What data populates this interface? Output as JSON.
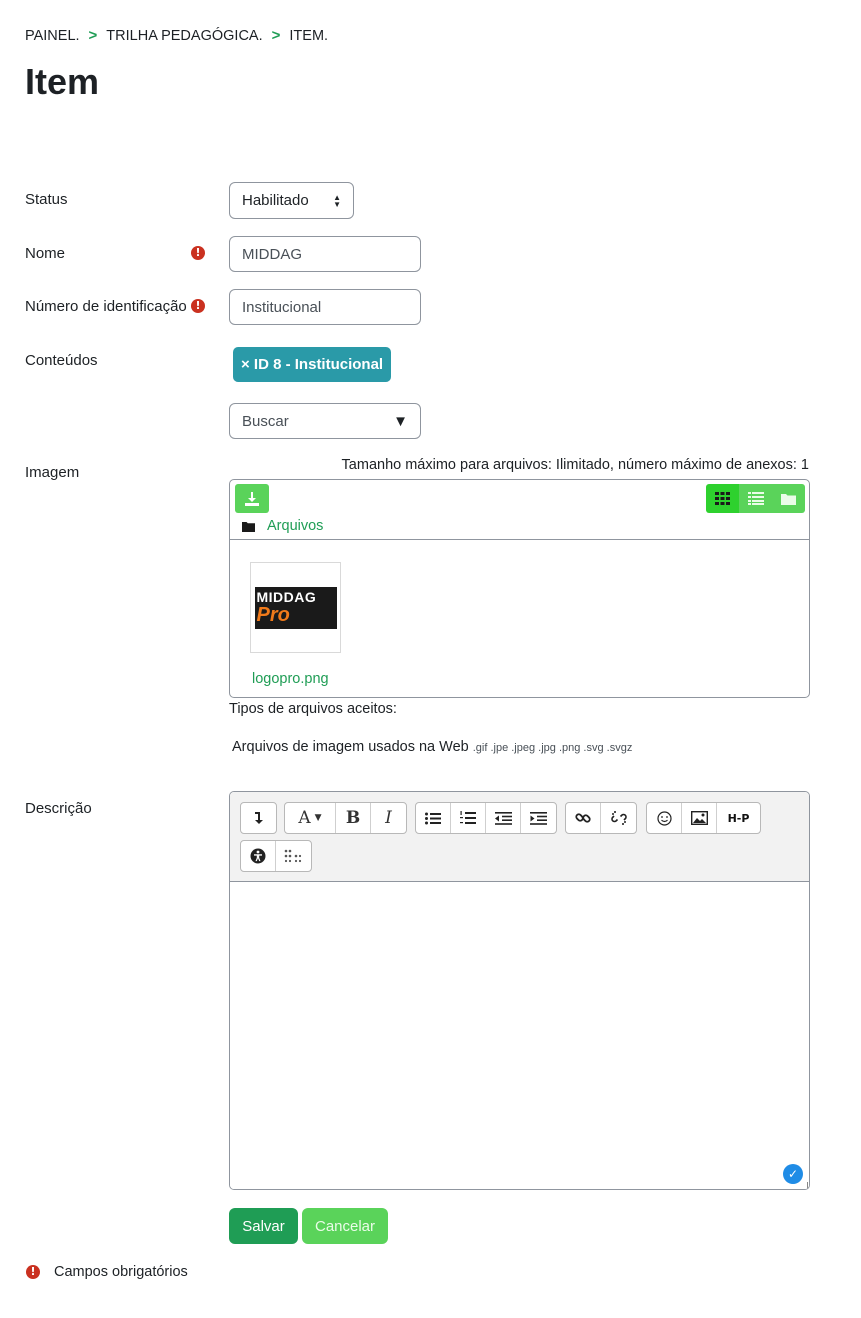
{
  "breadcrumb": {
    "items": [
      "PAINEL.",
      "TRILHA PEDAGÓGICA.",
      "ITEM."
    ],
    "separator": ">"
  },
  "page": {
    "title": "Item"
  },
  "form": {
    "status": {
      "label": "Status",
      "value": "Habilitado"
    },
    "nome": {
      "label": "Nome",
      "value": "MIDDAG",
      "required_icon": "!"
    },
    "idnumber": {
      "label": "Número de identificação",
      "value": "Institucional",
      "required_icon": "!"
    },
    "conteudos": {
      "label": "Conteúdos",
      "tag": "× ID 8 - Institucional",
      "search_placeholder": "Buscar",
      "dropdown_glyph": "▼"
    },
    "imagem": {
      "label": "Imagem",
      "max_size": "Tamanho máximo para arquivos: Ilimitado, número máximo de anexos: 1",
      "path": "Arquivos",
      "file_name": "logopro.png",
      "logo_top": "MIDDAG",
      "logo_bottom": "Pro",
      "accepted_label": "Tipos de arquivos aceitos:",
      "accepted_types": "Arquivos de imagem usados na Web",
      "accepted_ext": ".gif .jpe .jpeg .jpg .png .svg .svgz"
    },
    "descricao": {
      "label": "Descrição",
      "toolbar": {
        "bold": "B",
        "italic": "I",
        "font": "A",
        "h5p": "H-P"
      }
    }
  },
  "buttons": {
    "save": "Salvar",
    "cancel": "Cancelar"
  },
  "footer": {
    "required_note": "Campos obrigatórios",
    "required_icon": "!"
  },
  "colors": {
    "accent_green": "#1f9d55",
    "light_green": "#5ad35a",
    "tag_teal": "#2a9aa8",
    "required_red": "#ca3120"
  }
}
